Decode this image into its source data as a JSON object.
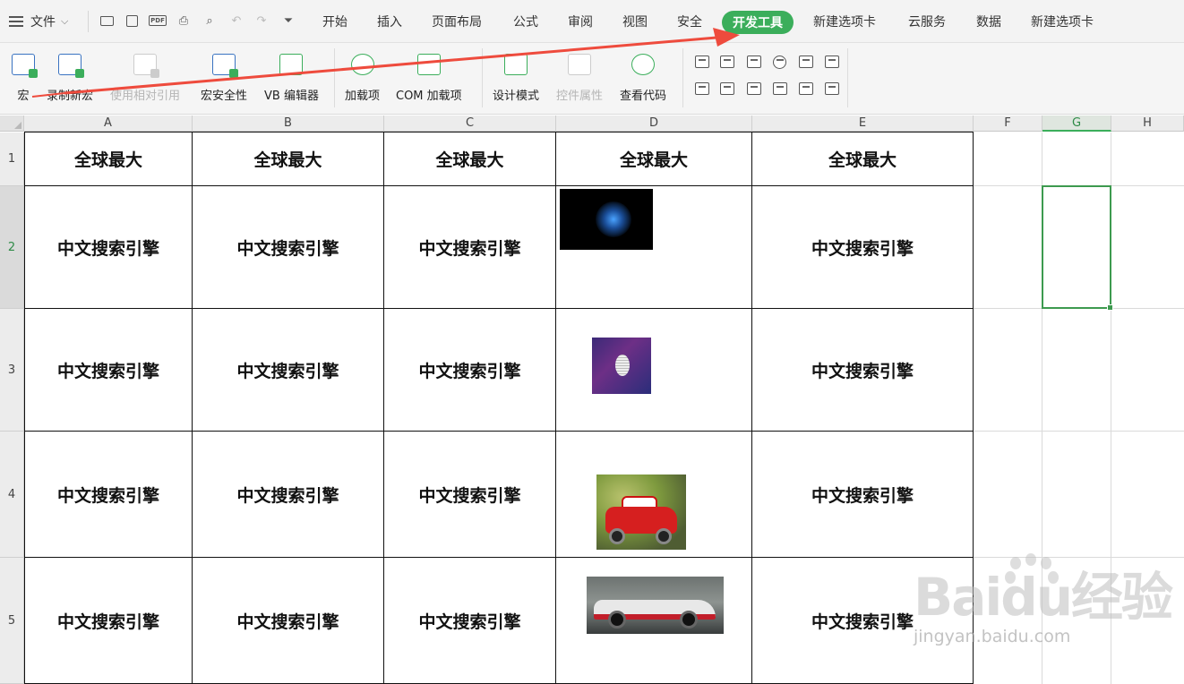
{
  "menubar": {
    "file_label": "文件",
    "tabs": [
      "开始",
      "插入",
      "页面布局",
      "公式",
      "审阅",
      "视图",
      "安全",
      "开发工具",
      "新建选项卡",
      "云服务",
      "数据",
      "新建选项卡"
    ],
    "active_tab": "开发工具",
    "active_color": "#3bae5b"
  },
  "ribbon": {
    "buttons": [
      {
        "label": "宏",
        "enabled": true
      },
      {
        "label": "录制新宏",
        "enabled": true
      },
      {
        "label": "使用相对引用",
        "enabled": false
      },
      {
        "label": "宏安全性",
        "enabled": true
      },
      {
        "label": "VB 编辑器",
        "enabled": true
      },
      {
        "label": "加载项",
        "enabled": true
      },
      {
        "label": "COM 加载项",
        "enabled": true
      },
      {
        "label": "设计模式",
        "enabled": true
      },
      {
        "label": "控件属性",
        "enabled": false
      },
      {
        "label": "查看代码",
        "enabled": true
      }
    ],
    "controls": [
      "checkbox-control-icon",
      "label-control-icon",
      "textbox-control-icon",
      "radio-control-icon",
      "spin-control-icon",
      "listbox-control-icon",
      "scrollbar-control-icon",
      "combobox-control-icon",
      "dropdown-control-icon",
      "frame-control-icon",
      "image-control-icon",
      "toggle-control-icon"
    ]
  },
  "grid": {
    "columns": [
      "A",
      "B",
      "C",
      "D",
      "E",
      "F",
      "G",
      "H"
    ],
    "rows": [
      "1",
      "2",
      "3",
      "4",
      "5"
    ],
    "selected_column": "G",
    "selected_row": "2",
    "header_row": [
      "全球最大",
      "全球最大",
      "全球最大",
      "全球最大",
      "全球最大"
    ],
    "body_text": "中文搜索引擎"
  },
  "colors": {
    "accent": "#3bae5b",
    "arrow": "#ee4b3d",
    "selection": "#3d9a4f"
  },
  "watermark": {
    "logo": "Baidu经验",
    "site": "jingyan.baidu.com"
  }
}
